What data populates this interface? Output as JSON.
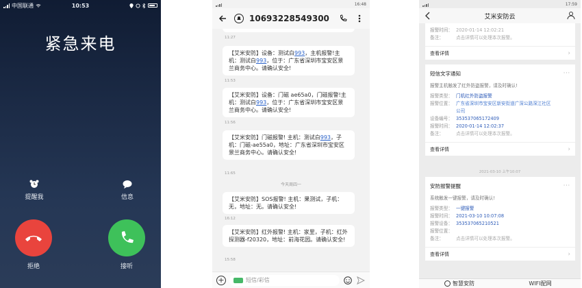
{
  "colors": {
    "decline": "#e9443d",
    "accept": "#3ec15a",
    "link": "#2a62c9",
    "call_bg": "#1b2a45"
  },
  "call": {
    "status_carrier": "中国联通",
    "status_time": "10:53",
    "title": "紧急来电",
    "remind_label": "提醒我",
    "message_label": "信息",
    "decline_label": "拒绝",
    "accept_label": "接听"
  },
  "sms": {
    "status_time": "16:48",
    "number": "10693228549300",
    "messages": [
      {
        "time": "11:27",
        "parts": [
          "【艾米安防】设备：测试白",
          "993",
          "，主机报警!主机：测试白",
          "993",
          "，位于：广东省深圳市宝安区景兰商务中心。请确认安全!"
        ]
      },
      {
        "time": "11:53",
        "parts": [
          "【艾米安防】设备：门磁 ae65a0，门磁报警!主机：测试白",
          "993",
          "，位于：广东省深圳市宝安区景兰商务中心。请确认安全!",
          "",
          ""
        ]
      },
      {
        "time": "11:56",
        "parts": [
          "【艾米安防】门磁报警! 主机：测试白",
          "993",
          "，子机：门磁-ae55a0，地址：广东省深圳市宝安区景兰商务中心。请确认安全!",
          "",
          ""
        ]
      },
      {
        "time": "11:65",
        "parts": [
          "",
          "",
          "",
          "",
          ""
        ]
      },
      {
        "time": "16:12",
        "parts": [
          "【艾米安防】SOS报警! 主机：果测试，子机：无，地址：无。请确认安全!",
          "",
          "",
          "",
          ""
        ]
      },
      {
        "time": "15:58",
        "parts": [
          "【艾米安防】红外报警! 主机：家里，子机：红外探测器-f20320，地址：前海花园。请确认安全!",
          "",
          "",
          "",
          ""
        ]
      }
    ],
    "day_divider": "今天周四一",
    "compose_placeholder": "短信/彩信"
  },
  "app": {
    "status_time": "17:59",
    "title": "艾米安防云",
    "card1": {
      "rows": [
        {
          "k": "报警时间：",
          "v": "2020-01-14 12:02:21"
        },
        {
          "k": "备注：",
          "v": "点击详情可以处理本次报警。"
        }
      ],
      "detail": "查看详情"
    },
    "card2": {
      "title": "短信文字通知",
      "more": "···",
      "sub": "报警主机触发了红外防盗报警，请及时确认!",
      "rows": [
        {
          "k": "报警类型：",
          "v": "门机红外防盗报警"
        },
        {
          "k": "报警位置：",
          "v": "广东省深圳市宝安区新安街道广深公路深江社区公司"
        },
        {
          "k": "设备编号：",
          "v": "353537065172409"
        },
        {
          "k": "报警时间：",
          "v": "2020-01-14 12:02:37"
        },
        {
          "k": "备注：",
          "v": "点击详情可以处理本次报警。"
        }
      ],
      "detail": "查看详情"
    },
    "stamp": "2021-03-10 上午10:07",
    "card3": {
      "title": "安防报警提醒",
      "more": "···",
      "sub": "系统触发一键报警，请及时确认!",
      "rows": [
        {
          "k": "报警类型：",
          "v": "一键报警"
        },
        {
          "k": "报警时间：",
          "v": "2021-03-10 10:07:08"
        },
        {
          "k": "报警设备：",
          "v": "353537065210521"
        },
        {
          "k": "报警位置：",
          "v": ""
        },
        {
          "k": "备注：",
          "v": "点击详情可以处理本次报警。"
        }
      ],
      "detail": "查看详情"
    },
    "tabs": [
      "智慧安防",
      "WIFI配网"
    ]
  }
}
